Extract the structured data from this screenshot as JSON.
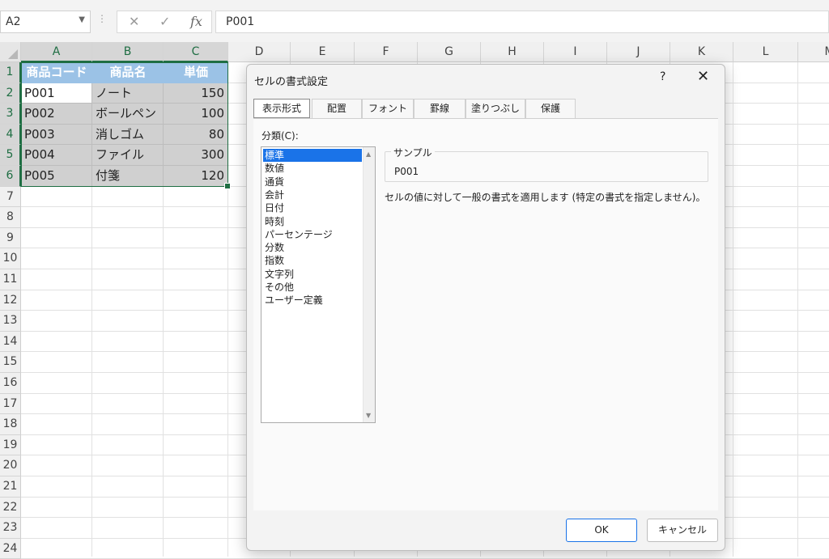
{
  "formula_bar": {
    "name_box": "A2",
    "cancel_icon": "✕",
    "enter_icon": "✓",
    "fx_label": "fx",
    "formula": "P001"
  },
  "columns": [
    "A",
    "B",
    "C",
    "D",
    "E",
    "F",
    "G",
    "H",
    "I",
    "J",
    "K",
    "L",
    "M"
  ],
  "rows": [
    "1",
    "2",
    "3",
    "4",
    "5",
    "6",
    "7",
    "8",
    "9",
    "10",
    "11",
    "12",
    "13",
    "14",
    "15",
    "16",
    "17",
    "18",
    "19",
    "20",
    "21",
    "22",
    "23",
    "24"
  ],
  "table": {
    "headers": [
      "商品コード",
      "商品名",
      "単価"
    ],
    "rows": [
      [
        "P001",
        "ノート",
        "150"
      ],
      [
        "P002",
        "ボールペン",
        "100"
      ],
      [
        "P003",
        "消しゴム",
        "80"
      ],
      [
        "P004",
        "ファイル",
        "300"
      ],
      [
        "P005",
        "付箋",
        "120"
      ]
    ]
  },
  "dialog": {
    "title": "セルの書式設定",
    "help": "?",
    "close": "✕",
    "tabs": [
      "表示形式",
      "配置",
      "フォント",
      "罫線",
      "塗りつぶし",
      "保護"
    ],
    "category_label": "分類(C):",
    "categories": [
      "標準",
      "数値",
      "通貨",
      "会計",
      "日付",
      "時刻",
      "パーセンテージ",
      "分数",
      "指数",
      "文字列",
      "その他",
      "ユーザー定義"
    ],
    "selected_category": "標準",
    "sample_label": "サンプル",
    "sample_value": "P001",
    "description": "セルの値に対して一般の書式を適用します (特定の書式を指定しません)。",
    "ok_label": "OK",
    "cancel_label": "キャンセル"
  }
}
